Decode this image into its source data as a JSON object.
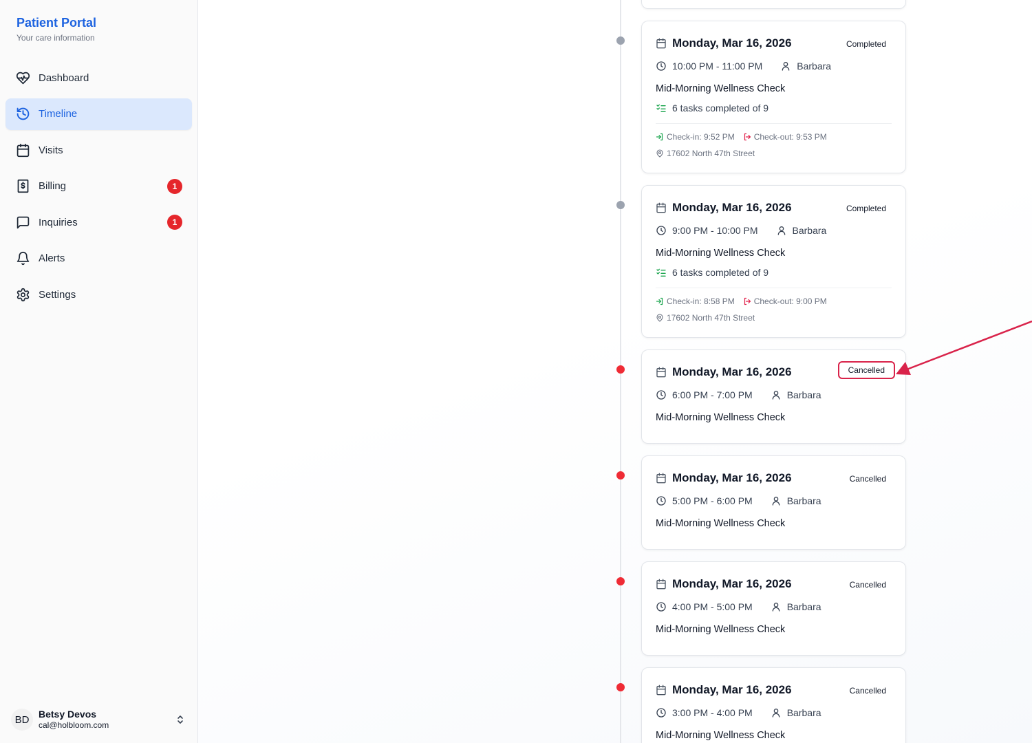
{
  "app": {
    "title": "Patient Portal",
    "subtitle": "Your care information"
  },
  "nav": [
    {
      "label": "Dashboard",
      "icon": "heart-pulse-icon",
      "active": false,
      "badge": null
    },
    {
      "label": "Timeline",
      "icon": "history-icon",
      "active": true,
      "badge": null
    },
    {
      "label": "Visits",
      "icon": "calendar-icon",
      "active": false,
      "badge": null
    },
    {
      "label": "Billing",
      "icon": "receipt-dollar-icon",
      "active": false,
      "badge": "1"
    },
    {
      "label": "Inquiries",
      "icon": "message-square-icon",
      "active": false,
      "badge": "1"
    },
    {
      "label": "Alerts",
      "icon": "bell-icon",
      "active": false,
      "badge": null
    },
    {
      "label": "Settings",
      "icon": "gear-icon",
      "active": false,
      "badge": null
    }
  ],
  "user": {
    "initials": "BD",
    "name": "Betsy Devos",
    "email": "cal@holbloom.com"
  },
  "colors": {
    "accent": "#1d63e0",
    "active_bg": "#dbe8fd",
    "badge": "#e5262b",
    "completed_dot": "#9ca3af",
    "cancelled_dot": "#ef2b35",
    "annotation": "#d9234a",
    "checkin": "#16a34a",
    "checkout": "#e11d48"
  },
  "visits": [
    {
      "date": "Monday, Mar 16, 2026",
      "status": "Completed",
      "time": "10:00 PM - 11:00 PM",
      "caregiver": "Barbara",
      "title": "Mid-Morning Wellness Check",
      "tasks": "6 tasks completed of 9",
      "checkin": "Check-in: 9:52 PM",
      "checkout": "Check-out: 9:53 PM",
      "address": "17602 North 47th Street"
    },
    {
      "date": "Monday, Mar 16, 2026",
      "status": "Completed",
      "time": "9:00 PM - 10:00 PM",
      "caregiver": "Barbara",
      "title": "Mid-Morning Wellness Check",
      "tasks": "6 tasks completed of 9",
      "checkin": "Check-in: 8:58 PM",
      "checkout": "Check-out: 9:00 PM",
      "address": "17602 North 47th Street"
    },
    {
      "date": "Monday, Mar 16, 2026",
      "status": "Cancelled",
      "time": "6:00 PM - 7:00 PM",
      "caregiver": "Barbara",
      "title": "Mid-Morning Wellness Check"
    },
    {
      "date": "Monday, Mar 16, 2026",
      "status": "Cancelled",
      "time": "5:00 PM - 6:00 PM",
      "caregiver": "Barbara",
      "title": "Mid-Morning Wellness Check"
    },
    {
      "date": "Monday, Mar 16, 2026",
      "status": "Cancelled",
      "time": "4:00 PM - 5:00 PM",
      "caregiver": "Barbara",
      "title": "Mid-Morning Wellness Check"
    },
    {
      "date": "Monday, Mar 16, 2026",
      "status": "Cancelled",
      "time": "3:00 PM - 4:00 PM",
      "caregiver": "Barbara",
      "title": "Mid-Morning Wellness Check"
    }
  ]
}
